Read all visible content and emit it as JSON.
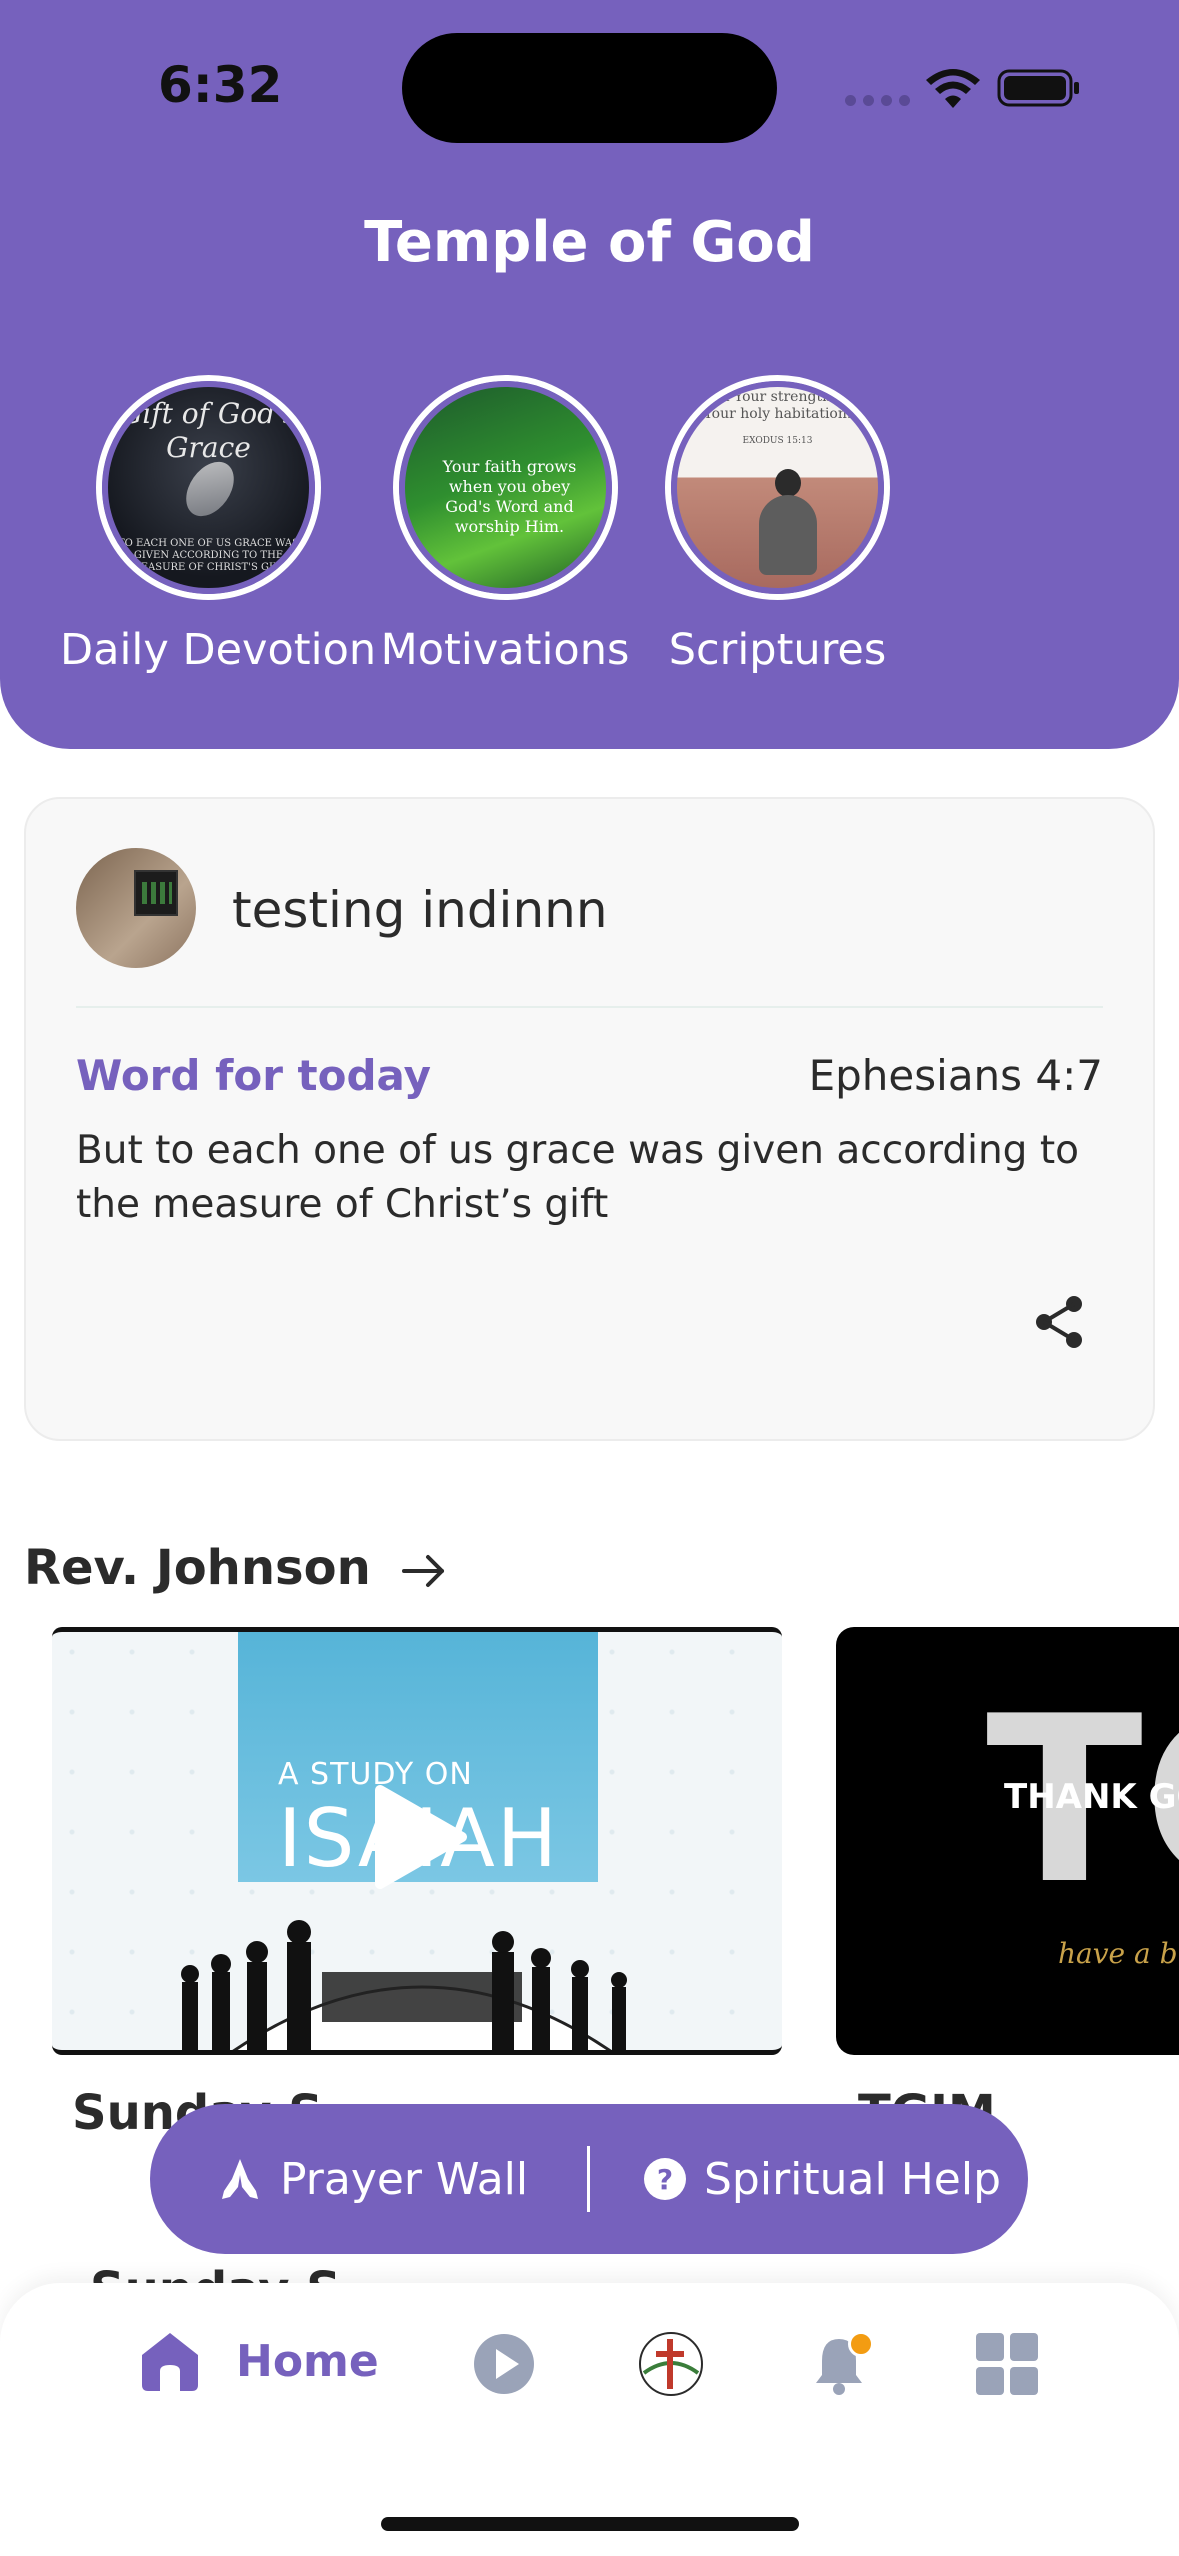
{
  "status_bar": {
    "time": "6:32"
  },
  "header": {
    "title": "Temple of God",
    "stories": [
      {
        "label": "Daily Devotion",
        "art_title": "Gift of God's Grace",
        "art_caption": "TO EACH ONE OF US GRACE WAS GIVEN ACCORDING TO THE MEASURE OF CHRIST'S GIFT"
      },
      {
        "label": "Motivations",
        "art_text": "Your faith grows when you obey God's Word and worship Him."
      },
      {
        "label": "Scriptures",
        "art_text": "...in Your strength To Your holy habitation.",
        "art_ref": "EXODUS 15:13"
      }
    ]
  },
  "word_card": {
    "user_name": "testing indinnn",
    "label": "Word for today",
    "reference": "Ephesians 4:7",
    "verse": "But to each one of us grace was given according to the measure of Christ’s gift"
  },
  "section": {
    "title": "Rev. Johnson",
    "videos": [
      {
        "art_subtitle": "A STUDY ON",
        "art_title": "ISAIAH",
        "title": "Sunday S"
      },
      {
        "art_title": "TG",
        "art_text": "THANK GO",
        "art_script": "have a b",
        "title": "TGIM"
      }
    ],
    "next_row_title": "Sunday S"
  },
  "pill": {
    "prayer_wall": "Prayer Wall",
    "spiritual_help": "Spiritual Help"
  },
  "nav": {
    "home_label": "Home"
  },
  "colors": {
    "brand": "#7661BD",
    "badge": "#f39c12"
  }
}
